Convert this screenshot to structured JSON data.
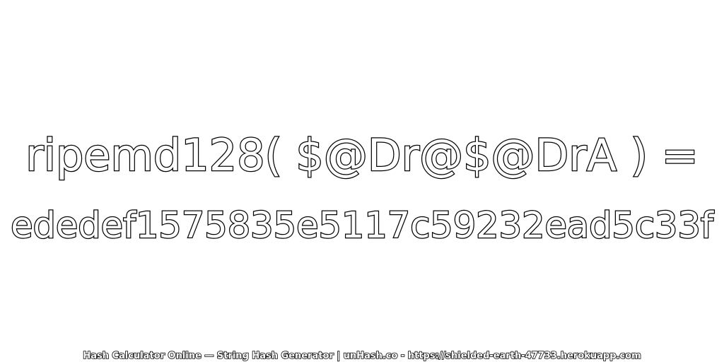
{
  "expression": "ripemd128( $@Dr@$@DrA ) =",
  "hash_value": "ededef1575835e5117c59232ead5c33f",
  "footer": "Hash Calculator Online — String Hash Generator | unHash.co - https://shielded-earth-47733.herokuapp.com",
  "colors": {
    "background": "#ffffff",
    "text_fill": "#ffffff",
    "text_outline": "#000000"
  }
}
